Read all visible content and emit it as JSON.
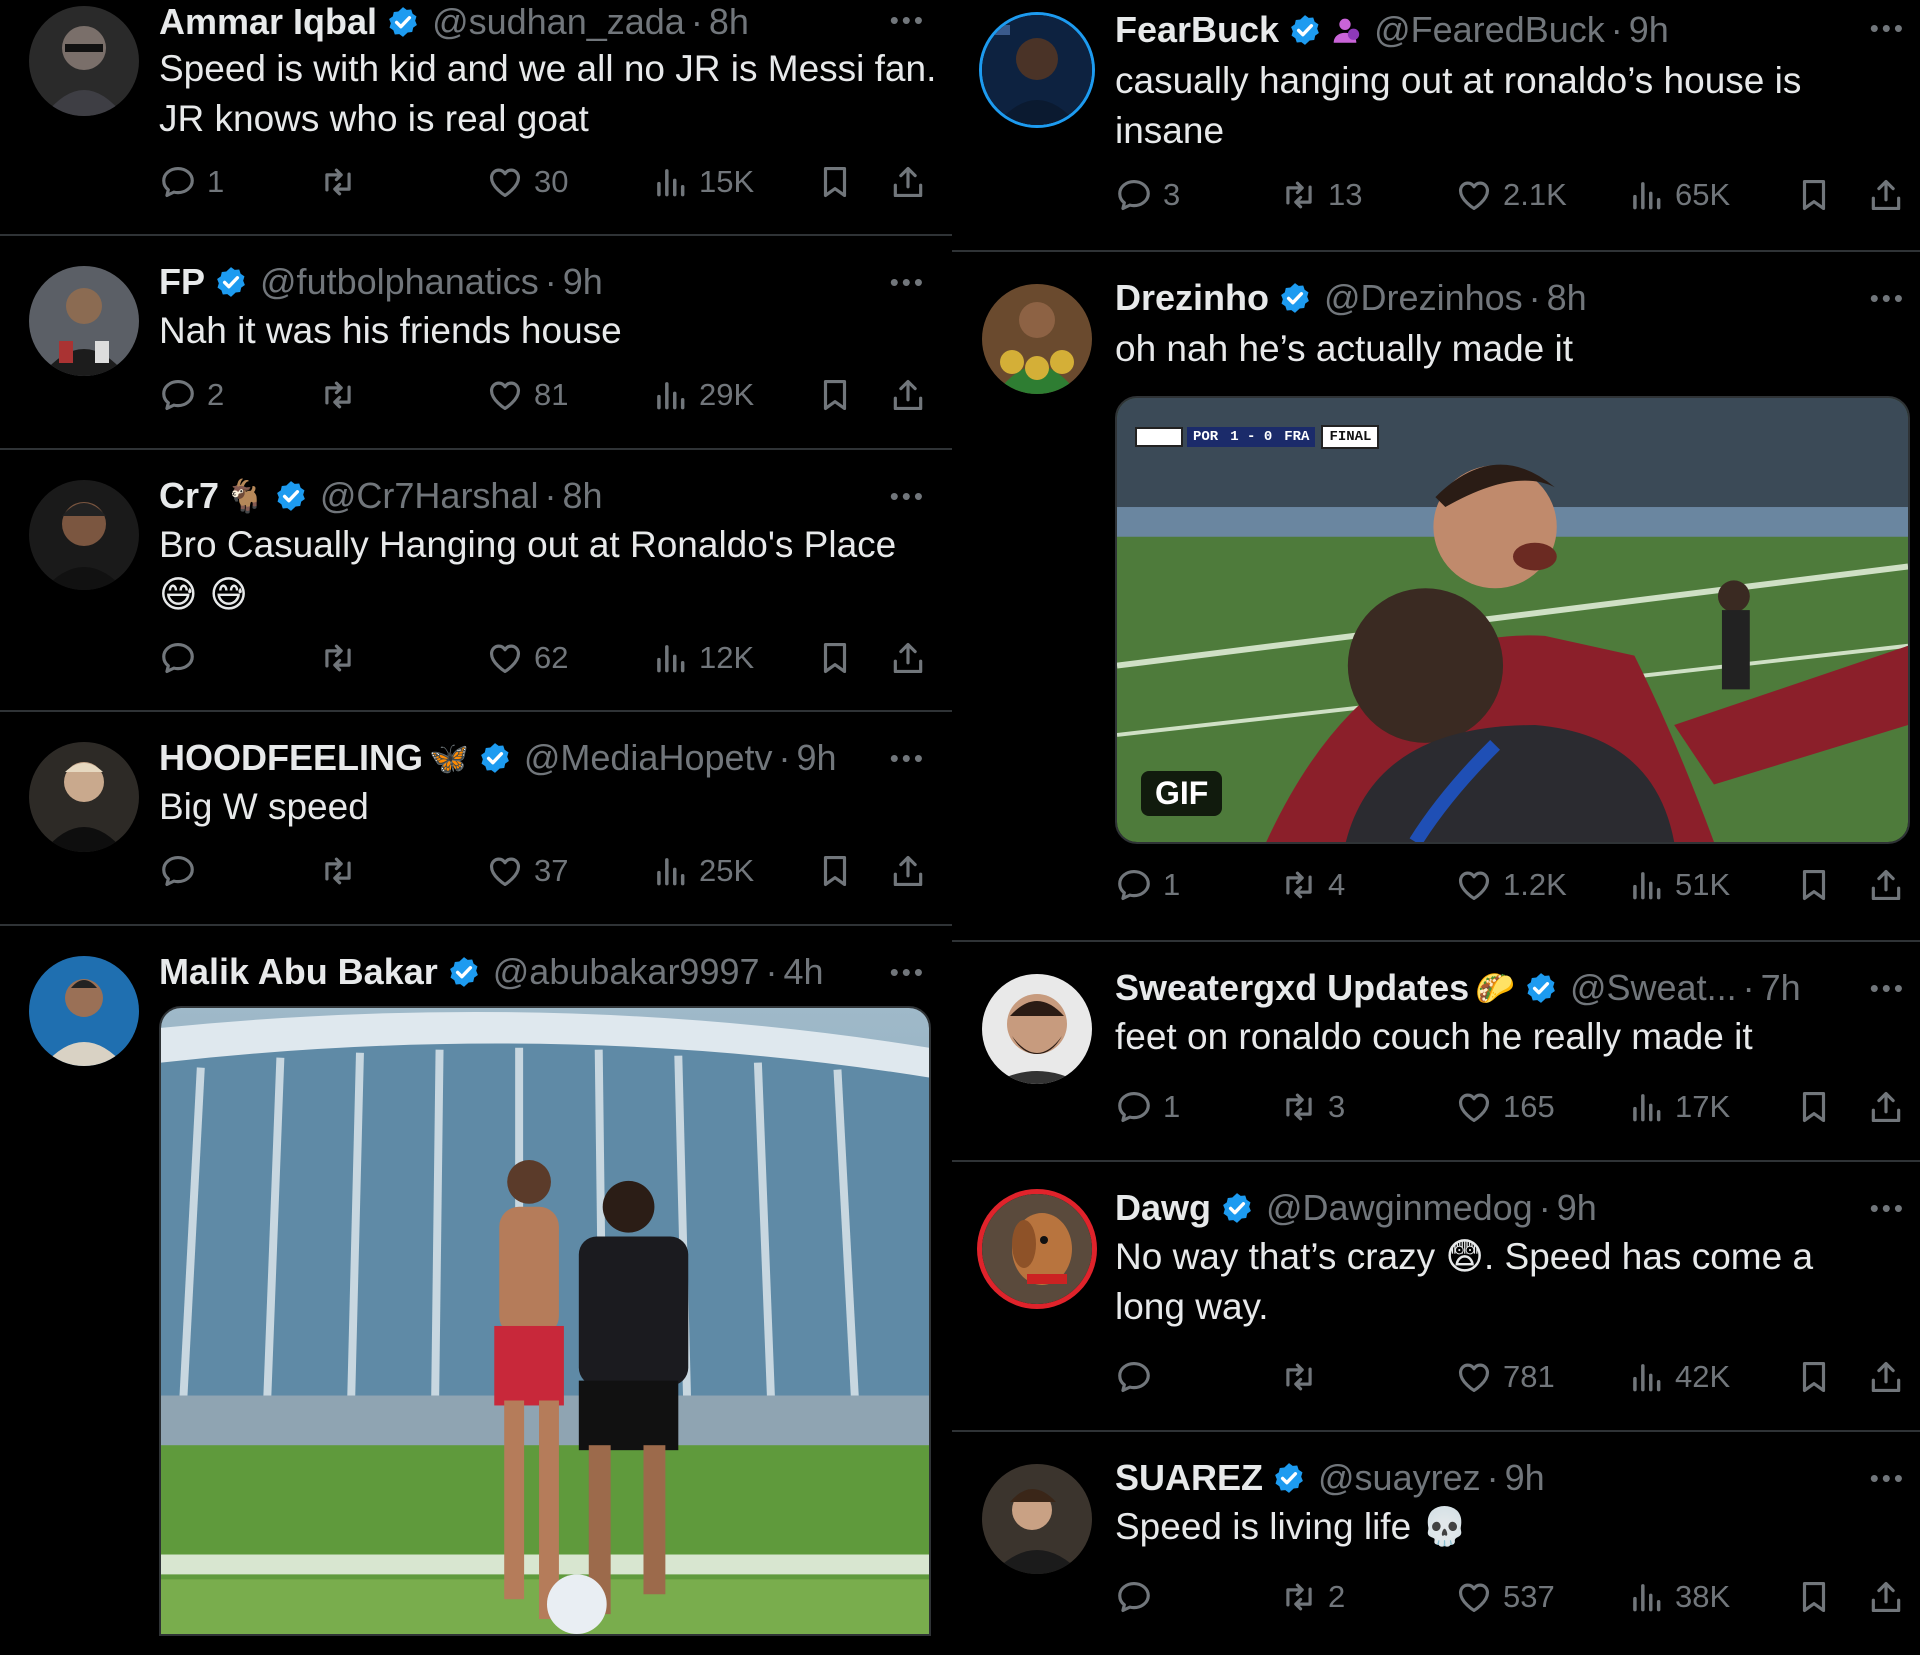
{
  "colors": {
    "background": "#000000",
    "text": "#e7e9ea",
    "muted": "#71767b",
    "verified": "#1d9bf0",
    "divider": "#2f3336"
  },
  "icons": {
    "reply": "speech-bubble-icon",
    "retweet": "retweet-icon",
    "like": "heart-icon",
    "views": "bar-chart-icon",
    "bookmark": "bookmark-icon",
    "share": "share-icon",
    "more": "ellipsis-icon"
  },
  "left": [
    {
      "name": "Ammar Iqbal",
      "handle": "@sudhan_zada",
      "time": "8h",
      "text": [
        "Speed is with kid and we all no JR is Messi fan.",
        "JR knows who is real goat"
      ],
      "replies": "1",
      "retweets": "",
      "likes": "30",
      "views": "15K"
    },
    {
      "name": "FP",
      "handle": "@futbolphanatics",
      "time": "9h",
      "text": [
        "Nah it was his friends house"
      ],
      "replies": "2",
      "retweets": "",
      "likes": "81",
      "views": "29K"
    },
    {
      "name": "Cr7",
      "name_emoji": "🐐",
      "handle": "@Cr7Harshal",
      "time": "8h",
      "text": [
        "Bro Casually Hanging out at Ronaldo's Place",
        "😅 😅"
      ],
      "replies": "",
      "retweets": "",
      "likes": "62",
      "views": "12K"
    },
    {
      "name": "HOODFEELING",
      "name_emoji": "🦋",
      "handle": "@MediaHopetv",
      "time": "9h",
      "text": [
        "Big W speed"
      ],
      "replies": "",
      "retweets": "",
      "likes": "37",
      "views": "25K"
    },
    {
      "name": "Malik Abu Bakar",
      "handle": "@abubakar9997",
      "time": "4h",
      "media": "photo"
    }
  ],
  "right": [
    {
      "name": "FearBuck",
      "affiliate_icon": "user-group-icon",
      "handle": "@FearedBuck",
      "time": "9h",
      "text": [
        "casually hanging out at ronaldo’s house is",
        "insane"
      ],
      "replies": "3",
      "retweets": "13",
      "likes": "2.1K",
      "views": "65K"
    },
    {
      "name": "Drezinho",
      "handle": "@Drezinhos",
      "time": "8h",
      "text": [
        "oh nah he’s actually made it"
      ],
      "media_badge": "GIF",
      "scoreboard": {
        "left": "POR",
        "score": "1 - 0",
        "right": "FRA",
        "status": "FINAL"
      },
      "replies": "1",
      "retweets": "4",
      "likes": "1.2K",
      "views": "51K"
    },
    {
      "name": "Sweatergxd Updates",
      "name_emoji": "🌮",
      "handle": "@Sweat...",
      "time": "7h",
      "text": [
        "feet on ronaldo couch he really made it"
      ],
      "replies": "1",
      "retweets": "3",
      "likes": "165",
      "views": "17K"
    },
    {
      "name": "Dawg",
      "handle": "@Dawginmedog",
      "time": "9h",
      "text": [
        "No way that’s crazy 😨. Speed has come a",
        "long way."
      ],
      "replies": "",
      "retweets": "",
      "likes": "781",
      "views": "42K"
    },
    {
      "name": "SUAREZ",
      "handle": "@suayrez",
      "time": "9h",
      "text": [
        "Speed is living life 💀"
      ],
      "replies": "",
      "retweets": "2",
      "likes": "537",
      "views": "38K"
    }
  ]
}
